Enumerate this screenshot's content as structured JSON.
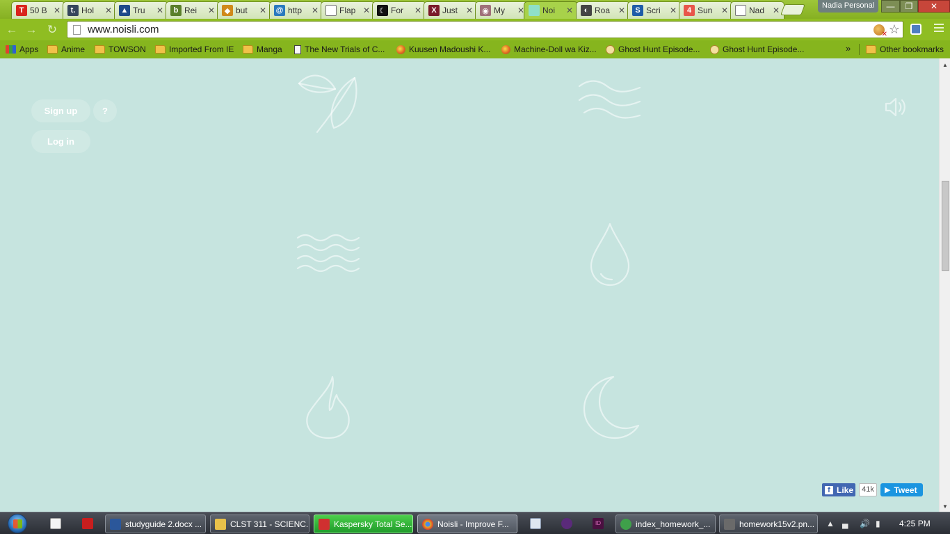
{
  "browser": {
    "profile_name": "Nadia Personal",
    "url": "www.noisli.com",
    "accent": "#8fbd22",
    "tabs": [
      {
        "label": "50 B",
        "favicon": "T",
        "favicon_color": "#d9251c"
      },
      {
        "label": "Hol",
        "favicon": "t.",
        "favicon_color": "#35465c"
      },
      {
        "label": "Tru",
        "favicon": "▲",
        "favicon_color": "#1f4a8a"
      },
      {
        "label": "Rei",
        "favicon": "b",
        "favicon_color": "#5a7f2a"
      },
      {
        "label": "but",
        "favicon": "◆",
        "favicon_color": "#d08a1a"
      },
      {
        "label": "http",
        "favicon": "@",
        "favicon_color": "#2a7abf"
      },
      {
        "label": "Flap",
        "favicon": "",
        "favicon_color": "#ffffff"
      },
      {
        "label": "For",
        "favicon": "☾",
        "favicon_color": "#111111"
      },
      {
        "label": "Just",
        "favicon": "X",
        "favicon_color": "#7a1a2a"
      },
      {
        "label": "My",
        "favicon": "◉",
        "favicon_color": "#a0707a"
      },
      {
        "label": "Noi",
        "favicon": "",
        "favicon_color": "#8fe0c8"
      },
      {
        "label": "Roa",
        "favicon": "◐",
        "favicon_color": "#444444"
      },
      {
        "label": "Scri",
        "favicon": "S",
        "favicon_color": "#1f5ca8"
      },
      {
        "label": "Sun",
        "favicon": "4",
        "favicon_color": "#e8564a"
      },
      {
        "label": "Nad",
        "favicon": "",
        "favicon_color": "#ffffff"
      }
    ],
    "window_buttons": {
      "minimize": "—",
      "maximize": "❐",
      "close": "✕"
    }
  },
  "bookmarks": {
    "items": [
      {
        "label": "Apps",
        "icon": "apps-grid-icon"
      },
      {
        "label": "Anime",
        "icon": "folder-icon"
      },
      {
        "label": "TOWSON",
        "icon": "folder-icon"
      },
      {
        "label": "Imported From IE",
        "icon": "folder-icon"
      },
      {
        "label": "Manga",
        "icon": "folder-icon"
      },
      {
        "label": "The New Trials of C...",
        "icon": "page-icon"
      },
      {
        "label": "Kuusen Madoushi K...",
        "icon": "site-icon"
      },
      {
        "label": "Machine-Doll wa Kiz...",
        "icon": "site-icon"
      },
      {
        "label": "Ghost Hunt Episode...",
        "icon": "ghost-site-icon"
      },
      {
        "label": "Ghost Hunt Episode...",
        "icon": "ghost-site-icon"
      }
    ],
    "overflow": "»",
    "other_bookmarks": "Other bookmarks"
  },
  "page": {
    "background": "#c6e4df",
    "sign_up": "Sign up",
    "help": "?",
    "log_in": "Log in",
    "sounds": [
      "rain",
      "wind",
      "water",
      "drop",
      "fire",
      "night"
    ],
    "social": {
      "like": "Like",
      "like_count": "41k",
      "tweet": "Tweet"
    }
  },
  "taskbar": {
    "tasks": [
      {
        "label": "studyguide 2.docx ...",
        "icon_color": "#2b579a"
      },
      {
        "label": "CLST 311 - SCIENC...",
        "icon_color": "#e8c14a"
      },
      {
        "label": "Kaspersky Total Se...",
        "icon_color": "#d03030"
      },
      {
        "label": "Noisli - Improve F...",
        "icon_color": "#e8b020"
      },
      {
        "label": "index_homework_...",
        "icon_color": "#3fa04a"
      },
      {
        "label": "homework15v2.pn...",
        "icon_color": "#6a6a6a"
      }
    ],
    "clock": "4:25 PM"
  }
}
